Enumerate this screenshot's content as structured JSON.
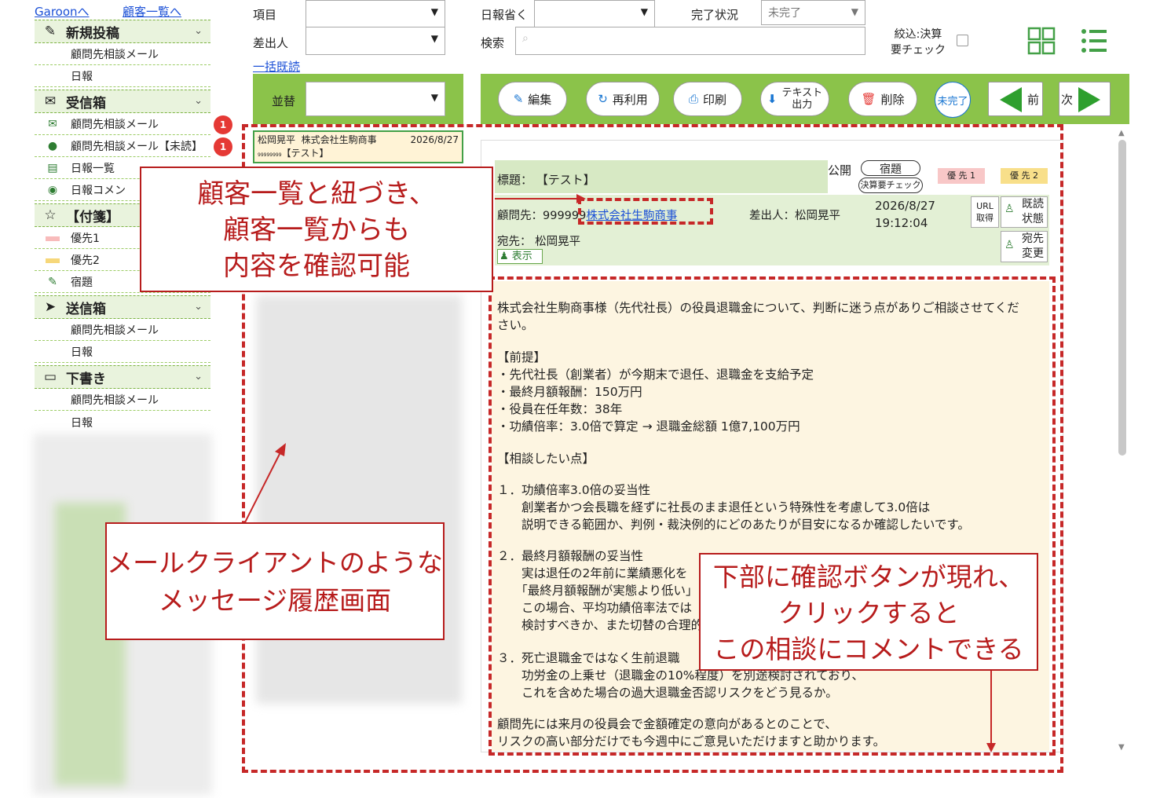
{
  "nav": {
    "garoon_link": "Garoonへ",
    "customer_list_link": "顧客一覧へ"
  },
  "sidebar": {
    "new_post": {
      "label": "新規投稿",
      "items": [
        "顧問先相談メール",
        "日報"
      ]
    },
    "inbox": {
      "label": "受信箱",
      "items": [
        {
          "label": "顧問先相談メール",
          "badge": "1"
        },
        {
          "label": "顧問先相談メール【未読】",
          "badge": "1"
        },
        {
          "label": "日報一覧",
          "badge": ""
        },
        {
          "label": "日報コメン",
          "badge": ""
        }
      ]
    },
    "tags": {
      "label": "【付箋】",
      "items": [
        "優先1",
        "優先2",
        "宿題"
      ]
    },
    "sent": {
      "label": "送信箱",
      "items": [
        "顧問先相談メール",
        "日報"
      ]
    },
    "drafts": {
      "label": "下書き",
      "items": [
        "顧問先相談メール",
        "日報"
      ]
    }
  },
  "filters": {
    "item_label": "項目",
    "sender_label": "差出人",
    "bulk_read": "一括既読",
    "exclude_label": "日報省く",
    "status_label": "完了状況",
    "status_value": "未完了",
    "search_label": "検索",
    "check_label_1": "絞込:決算",
    "check_label_2": "要チェック",
    "sort_label": "並替"
  },
  "toolbar": {
    "edit": "編集",
    "reuse": "再利用",
    "print": "印刷",
    "text_export_1": "テキスト",
    "text_export_2": "出力",
    "delete": "削除",
    "incomplete": "未完了",
    "prev": "前",
    "next": "次"
  },
  "list": {
    "items": [
      {
        "sender": "松岡晃平",
        "company": "株式会社生駒商事",
        "date": "2026/8/27",
        "id": "99999999",
        "title": "【テスト】"
      }
    ]
  },
  "detail": {
    "subject_label": "標題：",
    "subject": "【テスト】",
    "public_label": "公開",
    "homework_tag": "宿題",
    "settle_tag": "決算要チェック",
    "priority1": "優 先 1",
    "priority2": "優 先 2",
    "client_label": "顧問先：999999",
    "client_link": "株式会社生駒商事",
    "sender": "差出人：松岡晃平",
    "date": "2026/8/27",
    "time": "19:12:04",
    "url_btn_1": "URL",
    "url_btn_2": "取得",
    "read_btn_1": "既読",
    "read_btn_2": "状態",
    "to_label": "宛先：",
    "to": "松岡晃平",
    "show": "表示",
    "to_change_1": "宛先",
    "to_change_2": "変更"
  },
  "body": [
    "株式会社生駒商事様（先代社長）の役員退職金について、判断に迷う点がありご相談させてくだ",
    "さい。",
    "【前提】",
    "・先代社長（創業者）が今期末で退任、退職金を支給予定",
    "・最終月額報酬：150万円",
    "・役員在任年数：38年",
    "・功績倍率：3.0倍で算定 → 退職金総額 1億7,100万円",
    "【相談したい点】",
    "１．功績倍率3.0倍の妥当性",
    "　　創業者かつ会長職を経ずに社長のまま退任という特殊性を考慮して3.0倍は",
    "　　説明できる範囲か、判例・裁決例的にどのあたりが目安になるか確認したいです。",
    "２．最終月額報酬の妥当性",
    "　　実は退任の2年前に業績悪化を",
    "　　「最終月額報酬が実態より低い」",
    "　　この場合、平均功績倍率法では",
    "　　検討すべきか、また切替の合理的",
    "３．死亡退職金ではなく生前退職",
    "　　功労金の上乗せ（退職金の10%程度）を別途検討されており、",
    "　　これを含めた場合の過大退職金否認リスクをどう見るか。",
    "顧問先には来月の役員会で金額確定の意向があるとのことで、",
    "リスクの高い部分だけでも今週中にご意見いただけますと助かります。"
  ],
  "annotations": {
    "top_1": "顧客一覧と紐づき、",
    "top_2": "顧客一覧からも",
    "top_3": "内容を確認可能",
    "left_1": "メールクライアントのような",
    "left_2": "メッセージ履歴画面",
    "right_1": "下部に確認ボタンが現れ、",
    "right_2": "クリックすると",
    "right_3": "この相談にコメントできる"
  }
}
